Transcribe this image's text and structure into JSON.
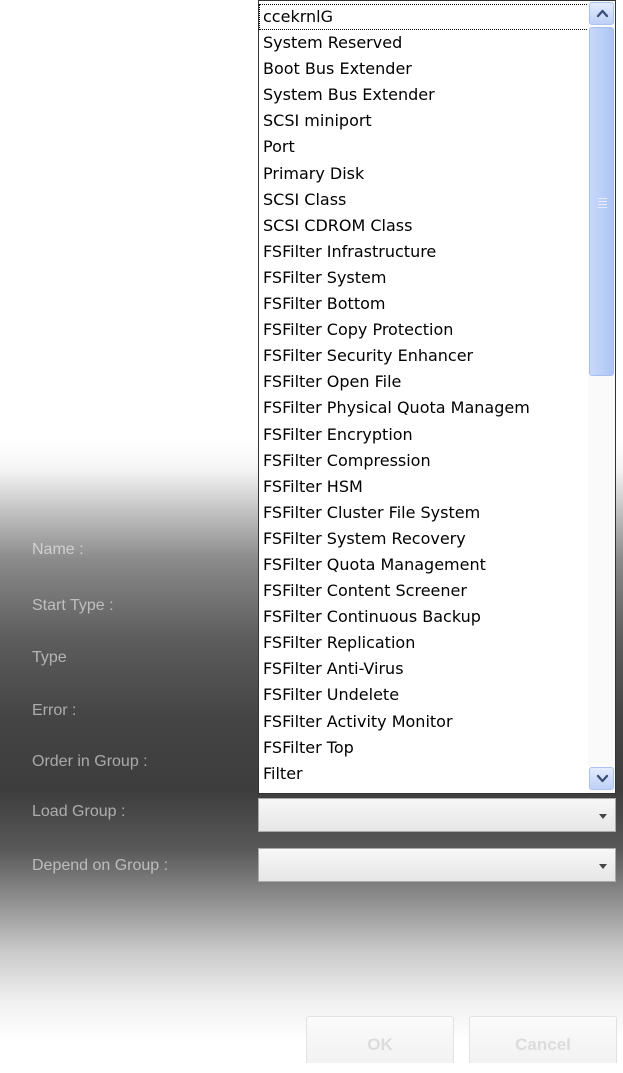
{
  "dropdown": {
    "items": [
      "ccekrnlG",
      "System Reserved",
      "Boot Bus Extender",
      "System Bus Extender",
      "SCSI miniport",
      "Port",
      "Primary Disk",
      "SCSI Class",
      "SCSI CDROM Class",
      "FSFilter Infrastructure",
      "FSFilter System",
      "FSFilter Bottom",
      "FSFilter Copy Protection",
      "FSFilter Security Enhancer",
      "FSFilter Open File",
      "FSFilter Physical Quota Managem",
      "FSFilter Encryption",
      "FSFilter Compression",
      "FSFilter HSM",
      "FSFilter Cluster File System",
      "FSFilter System Recovery",
      "FSFilter Quota Management",
      "FSFilter Content Screener",
      "FSFilter Continuous Backup",
      "FSFilter Replication",
      "FSFilter Anti-Virus",
      "FSFilter Undelete",
      "FSFilter Activity Monitor",
      "FSFilter Top",
      "Filter"
    ],
    "selected_index": 0
  },
  "form": {
    "name_label": "Name :",
    "start_type_label": "Start Type :",
    "type_label": "Type",
    "error_label": "Error :",
    "order_in_group_label": "Order in Group :",
    "load_group_label": "Load Group :",
    "load_group_value": "",
    "depend_on_group_label": "Depend on Group :",
    "depend_on_group_value": ""
  },
  "buttons": {
    "ok_label": "OK",
    "cancel_label": "Cancel"
  },
  "icons": {
    "scroll_up": "chevron-up-icon",
    "scroll_down": "chevron-down-icon",
    "combo_arrow": "caret-down-icon"
  },
  "colors": {
    "scrollbar_accent": "#b8cdf8"
  }
}
